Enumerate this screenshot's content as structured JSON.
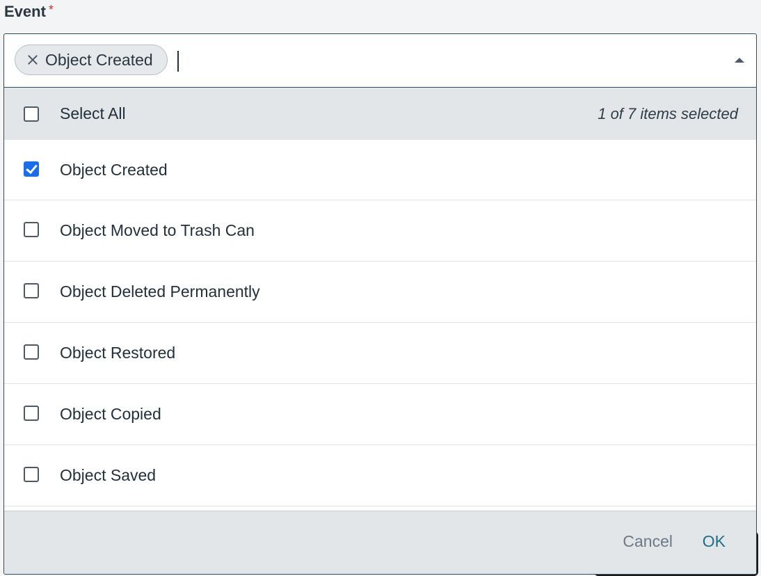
{
  "field": {
    "label": "Event",
    "required_mark": "*"
  },
  "combo": {
    "chips": [
      {
        "label": "Object Created"
      }
    ],
    "input_value": "",
    "toggle_icon": "caret-up-icon"
  },
  "select_all": {
    "label": "Select All",
    "checked": false,
    "count_text": "1 of 7 items selected"
  },
  "options": [
    {
      "label": "Object Created",
      "checked": true
    },
    {
      "label": "Object Moved to Trash Can",
      "checked": false
    },
    {
      "label": "Object Deleted Permanently",
      "checked": false
    },
    {
      "label": "Object Restored",
      "checked": false
    },
    {
      "label": "Object Copied",
      "checked": false
    },
    {
      "label": "Object Saved",
      "checked": false
    }
  ],
  "footer": {
    "cancel_label": "Cancel",
    "ok_label": "OK"
  },
  "colors": {
    "accent": "#1a6ee8",
    "ok_text": "#1f6e87",
    "required": "#c2372a"
  }
}
